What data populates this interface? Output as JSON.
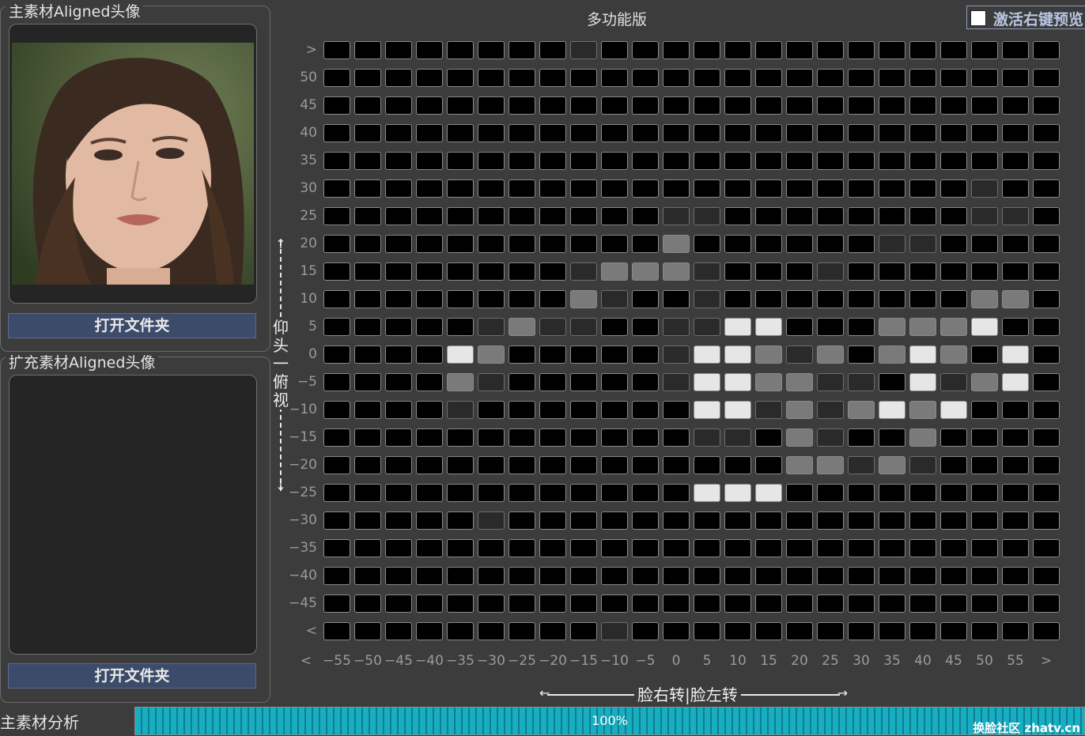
{
  "main_panel": {
    "title": "主素材Aligned头像",
    "button_label": "打开文件夹"
  },
  "ext_panel": {
    "title": "扩充素材Aligned头像",
    "button_label": "打开文件夹"
  },
  "grid": {
    "title": "多功能版",
    "checkbox_label": "激活右键预览",
    "checkbox_checked": false,
    "y_labels": [
      ">",
      "50",
      "45",
      "40",
      "35",
      "30",
      "25",
      "20",
      "15",
      "10",
      "5",
      "0",
      "−5",
      "−10",
      "−15",
      "−20",
      "−25",
      "−30",
      "−35",
      "−40",
      "−45",
      "<"
    ],
    "x_labels": [
      "<",
      "−55",
      "−50",
      "−45",
      "−40",
      "−35",
      "−30",
      "−25",
      "−20",
      "−15",
      "−10",
      "−5",
      "0",
      "5",
      "10",
      "15",
      "20",
      "25",
      "30",
      "35",
      "40",
      "45",
      "50",
      "55",
      ">"
    ],
    "levels_legend": {
      "0": "#000000",
      "1": "#2a2a2a",
      "2": "#7a7a7a",
      "3": "#e6e6e6"
    },
    "rows": [
      "000000001000000000000000",
      "000000000000000000000000",
      "000000000000000000000000",
      "000000000000000000000000",
      "000000000000000000000000",
      "000000000000000000000100",
      "000000000001100000000110",
      "000000000002000000110000",
      "000000001222100010000000",
      "000000002100100000000220",
      "000001211001133000222300",
      "000032000001332120232030",
      "000021000001332211031230",
      "000010000000331212323000",
      "000000000000110210020000",
      "000000000000000221210000",
      "000000000000333000000000",
      "000001000000000000000000",
      "000000000000000000000000",
      "000000000000000000000000",
      "000000000000000000000000",
      "000000000100000000000000"
    ]
  },
  "pitch_axis": {
    "label": "仰头一俯视"
  },
  "yaw_axis": {
    "label": "脸右转|脸左转"
  },
  "status": {
    "label": "主素材分析",
    "progress_percent": 100,
    "progress_text": "100%"
  },
  "watermark": "换脸社区 zhatv.cn"
}
